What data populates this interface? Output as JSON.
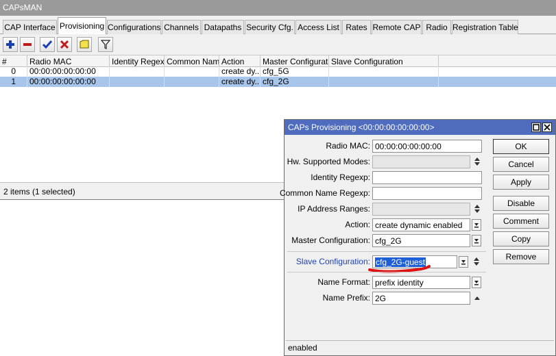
{
  "app": {
    "title": "CAPsMAN"
  },
  "tabs": [
    "CAP Interface",
    "Provisioning",
    "Configurations",
    "Channels",
    "Datapaths",
    "Security Cfg.",
    "Access List",
    "Rates",
    "Remote CAP",
    "Radio",
    "Registration Table"
  ],
  "active_tab": "Provisioning",
  "table": {
    "columns": [
      "#",
      "Radio MAC",
      "Identity Regexp",
      "Common Nam...",
      "Action",
      "Master Configurati...",
      "Slave Configuration"
    ],
    "rows": [
      {
        "num": "0",
        "mac": "00:00:00:00:00:00",
        "identity": "",
        "common": "",
        "action": "create dy...",
        "master": "cfg_5G",
        "slave": ""
      },
      {
        "num": "1",
        "mac": "00:00:00:00:00:00",
        "identity": "",
        "common": "",
        "action": "create dy...",
        "master": "cfg_2G",
        "slave": ""
      }
    ],
    "status": "2 items (1 selected)"
  },
  "dialog": {
    "title": "CAPs Provisioning <00:00:00:00:00:00>",
    "fields": {
      "radio_mac": {
        "label": "Radio MAC:",
        "value": "00:00:00:00:00:00"
      },
      "hw_modes": {
        "label": "Hw. Supported Modes:",
        "value": ""
      },
      "identity": {
        "label": "Identity Regexp:",
        "value": ""
      },
      "common": {
        "label": "Common Name Regexp:",
        "value": ""
      },
      "ip_ranges": {
        "label": "IP Address Ranges:",
        "value": ""
      },
      "action": {
        "label": "Action:",
        "value": "create dynamic enabled"
      },
      "master": {
        "label": "Master Configuration:",
        "value": "cfg_2G"
      },
      "slave": {
        "label": "Slave Configuration:",
        "value": "cfg_2G-guest"
      },
      "name_format": {
        "label": "Name Format:",
        "value": "prefix identity"
      },
      "name_prefix": {
        "label": "Name Prefix:",
        "value": "2G"
      }
    },
    "buttons": {
      "ok": "OK",
      "cancel": "Cancel",
      "apply": "Apply",
      "disable": "Disable",
      "comment": "Comment",
      "copy": "Copy",
      "remove": "Remove"
    },
    "status": "enabled"
  },
  "colors": {
    "selection": "#a8c6ec",
    "dialog_title": "#4f6cbf",
    "highlight": "#1e5fd6",
    "annotation": "#e01010"
  }
}
